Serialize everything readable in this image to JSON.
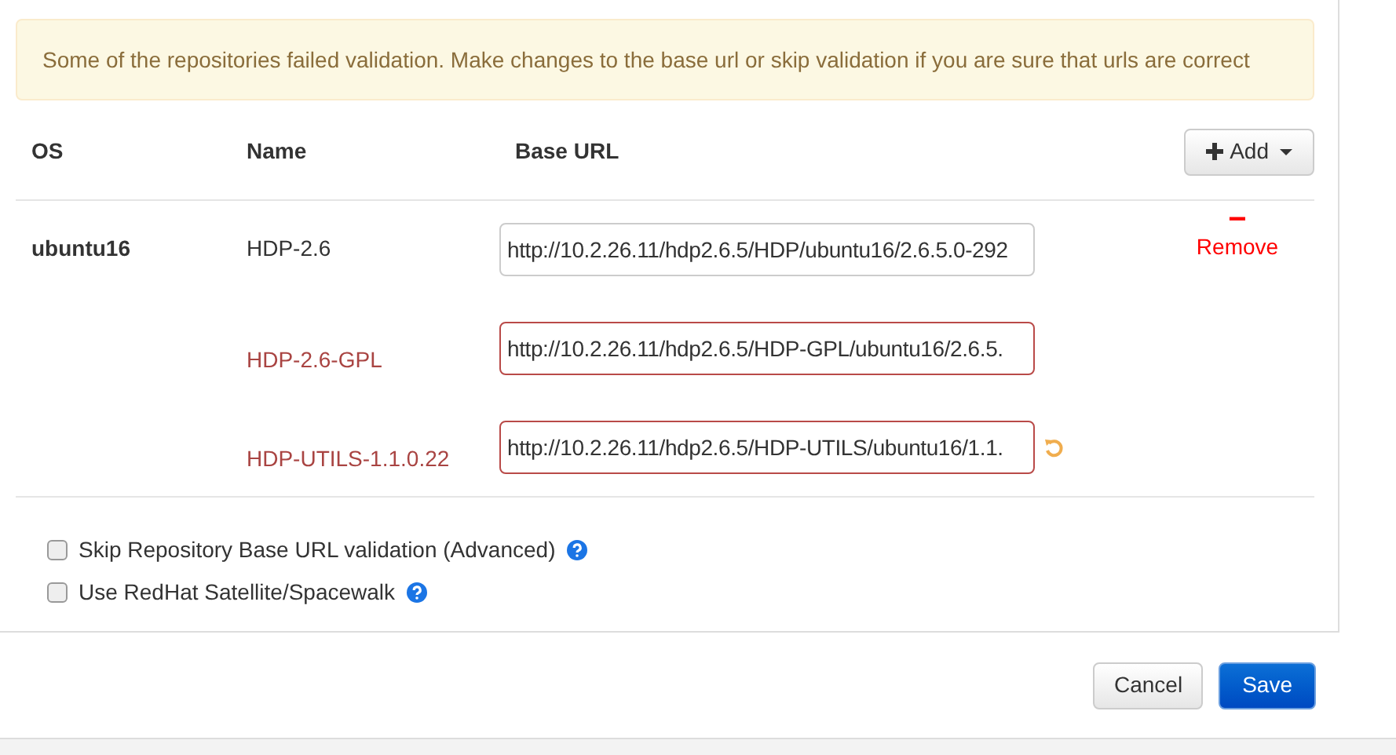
{
  "alert": {
    "message": "Some of the repositories failed validation. Make changes to the base url or skip validation if you are sure that urls are correct"
  },
  "table": {
    "columns": [
      "OS",
      "Name",
      "Base URL"
    ],
    "add_button": {
      "label": "Add"
    },
    "os_groups": [
      {
        "os": "ubuntu16",
        "repositories": [
          {
            "name": "HDP-2.6",
            "base_url": "http://10.2.26.11/hdp2.6.5/HDP/ubuntu16/2.6.5.0-292",
            "invalid": false,
            "undo": false,
            "remove": {
              "sign": "−",
              "label": "Remove"
            }
          },
          {
            "name": "HDP-2.6-GPL",
            "base_url": "http://10.2.26.11/hdp2.6.5/HDP-GPL/ubuntu16/2.6.5.",
            "invalid": true,
            "undo": false
          },
          {
            "name": "HDP-UTILS-1.1.0.22",
            "base_url": "http://10.2.26.11/hdp2.6.5/HDP-UTILS/ubuntu16/1.1.",
            "invalid": true,
            "undo": true
          }
        ]
      }
    ]
  },
  "options": [
    {
      "label": "Skip Repository Base URL validation (Advanced)",
      "checked": false
    },
    {
      "label": "Use RedHat Satellite/Spacewalk",
      "checked": false
    }
  ],
  "buttons": [
    {
      "label": "Cancel",
      "kind": "default"
    },
    {
      "label": "Save",
      "kind": "primary"
    }
  ]
}
